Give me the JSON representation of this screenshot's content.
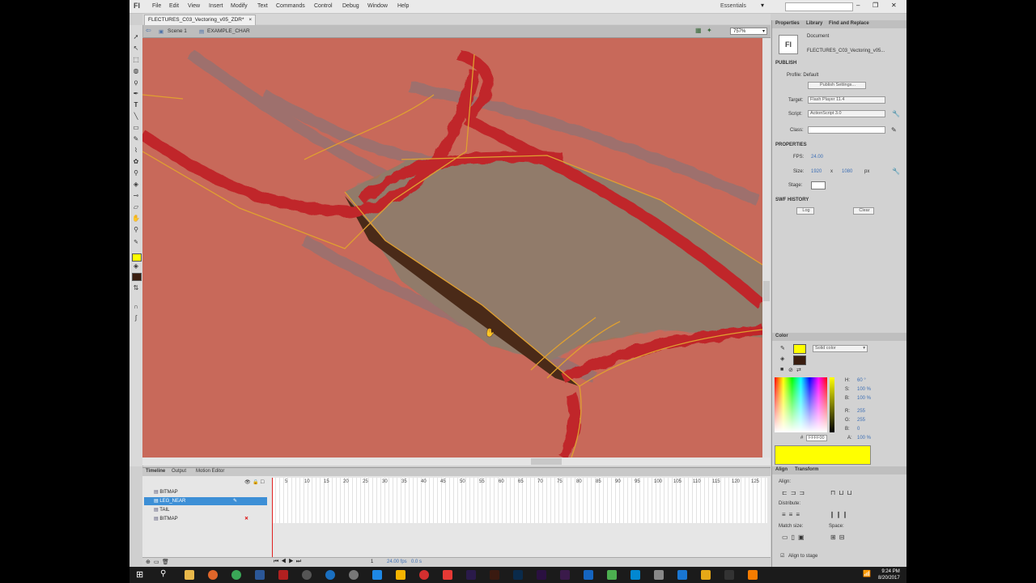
{
  "app": {
    "logo": "Fl"
  },
  "menu": [
    "File",
    "Edit",
    "View",
    "Insert",
    "Modify",
    "Text",
    "Commands",
    "Control",
    "Debug",
    "Window",
    "Help"
  ],
  "workspace": "Essentials",
  "window_controls": [
    "–",
    "❐",
    "✕"
  ],
  "document_tab": {
    "label": "FLECTURES_C03_Vectoring_v05_ZDR*",
    "close": "×"
  },
  "edit_bar": {
    "scene": "Scene 1",
    "symbol": "EXAMPLE_CHAR",
    "zoom": "757%"
  },
  "panel": {
    "tabs": [
      "Properties",
      "Library",
      "Find and Replace"
    ],
    "doc_type": "Document",
    "doc_icon": "Fl",
    "doc_name": "FLECTURES_C03_Vectoring_v05...",
    "publish_header": "PUBLISH",
    "profile": "Profile: Default",
    "publish_settings": "Publish Settings...",
    "target_label": "Target:",
    "target_value": "Flash Player 11.4",
    "script_label": "Script:",
    "script_value": "ActionScript 3.0",
    "class_label": "Class:",
    "properties_header": "PROPERTIES",
    "fps_label": "FPS:",
    "fps_value": "24.00",
    "size_label": "Size:",
    "size_w": "1920",
    "size_x": "x",
    "size_h": "1080",
    "size_unit": "px",
    "stage_label": "Stage:",
    "swf_header": "SWF HISTORY",
    "log_btn": "Log",
    "clear_btn": "Clear"
  },
  "color_panel": {
    "title": "Color",
    "fill_type": "Solid color",
    "h_label": "H:",
    "h_value": "60 °",
    "s_label": "S:",
    "s_value": "100 %",
    "b_label": "B:",
    "b_value": "100 %",
    "r_label": "R:",
    "r_value": "255",
    "g_label": "G:",
    "g_value": "255",
    "bb_label": "B:",
    "bb_value": "0",
    "hex_prefix": "#",
    "hex_value": "FFFF00",
    "alpha_label": "A:",
    "alpha_value": "100 %",
    "swatch_color": "#ffff00"
  },
  "align_panel": {
    "tabs": [
      "Align",
      "Transform"
    ],
    "align_label": "Align:",
    "distribute_label": "Distribute:",
    "match_label": "Match size:",
    "space_label": "Space:",
    "stage_check": "Align to stage"
  },
  "timeline": {
    "tabs": [
      "Timeline",
      "Output",
      "Motion Editor"
    ],
    "layers": [
      {
        "name": "BITMAP",
        "selected": false
      },
      {
        "name": "LEG_NEAR",
        "selected": true
      },
      {
        "name": "TAIL",
        "selected": false
      },
      {
        "name": "BITMAP",
        "selected": false
      }
    ],
    "frame_numbers": [
      "5",
      "10",
      "15",
      "20",
      "25",
      "30",
      "35",
      "40",
      "45",
      "50",
      "55",
      "60",
      "65",
      "70",
      "75",
      "80",
      "85",
      "90",
      "95",
      "100",
      "105",
      "110",
      "115",
      "120",
      "125"
    ],
    "fps_readout": "24.00 fps",
    "time_readout": "0.0 s",
    "frame_readout": "1"
  },
  "taskbar": {
    "time": "9:24 PM",
    "date": "8/20/2017"
  },
  "colors": {
    "stage": "#c96a5a",
    "accent": "#3d8fd6",
    "selected_layer": "#3d8fd6"
  }
}
